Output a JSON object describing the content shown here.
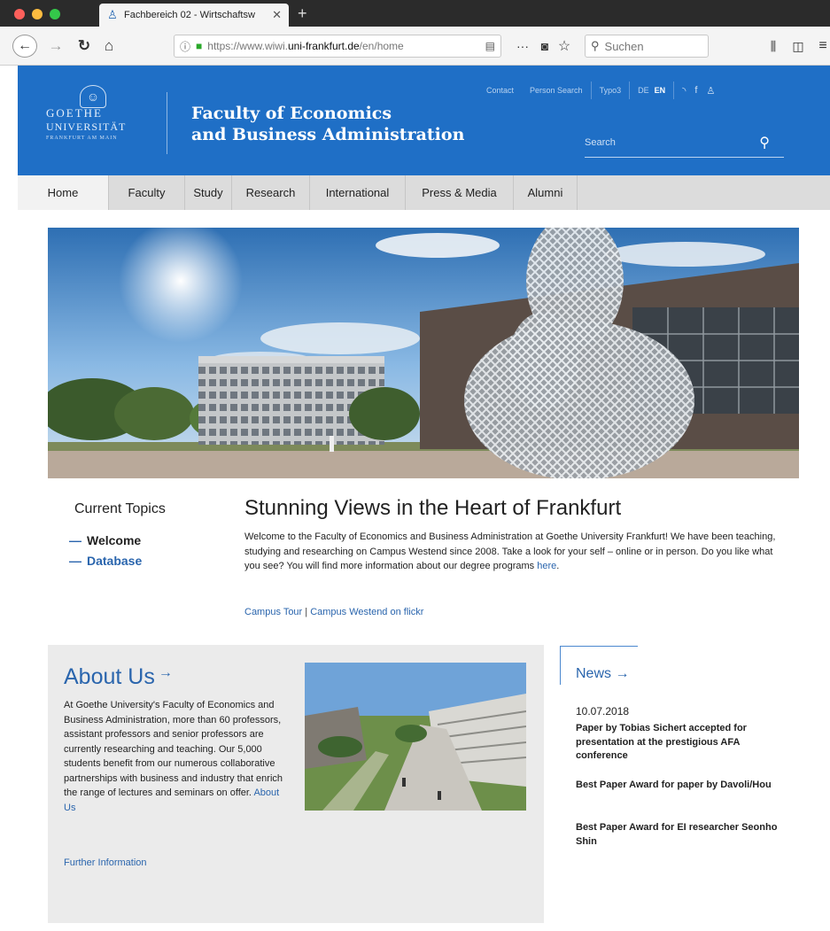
{
  "browser": {
    "tab_title": "Fachbereich 02 - Wirtschaftsw",
    "tab_close": "✕",
    "new_tab": "+",
    "url_prefix": "https://www.wiwi.",
    "url_domain": "uni-frankfurt.de",
    "url_path": "/en/home",
    "search_placeholder": "Suchen",
    "more_label": "···"
  },
  "header": {
    "logo_line1": "GOETHE",
    "logo_line2": "UNIVERSITÄT",
    "logo_line3": "FRANKFURT AM MAIN",
    "faculty_line1": "Faculty of Economics",
    "faculty_line2": "and Business Administration",
    "util_links": [
      "Contact",
      "Person Search",
      "Typo3"
    ],
    "lang_de": "DE",
    "lang_en": "EN",
    "search_label": "Search"
  },
  "nav": {
    "items": [
      "Home",
      "Faculty",
      "Study",
      "Research",
      "International",
      "Press & Media",
      "Alumni"
    ]
  },
  "topics": {
    "heading": "Current Topics",
    "items": [
      "Welcome",
      "Database"
    ],
    "dash": "—"
  },
  "intro": {
    "title": "Stunning Views in the Heart of Frankfurt",
    "text": "Welcome to the Faculty of Economics and Business Administration at Goethe University Frankfurt! We have been teaching, studying and researching on Campus Westend since 2008. Take a look for your self – online or in person. Do you like what you see? You will find more information about our degree programs ",
    "here_link": "here",
    "text_end": ".",
    "campus_tour": "Campus Tour",
    "link_separator": " | ",
    "campus_flickr": "Campus Westend on flickr"
  },
  "about": {
    "title": "About Us",
    "arrow": "→",
    "text": "At Goethe University's Faculty of Economics and Business Administration, more than 60 professors, assistant professors and senior professors are currently researching and teaching. Our 5,000 students benefit from our numerous collaborative partnerships with business and industry that enrich the range of lectures and seminars on offer. ",
    "about_link": "About Us",
    "further_info": "Further Information"
  },
  "news": {
    "title": "News →",
    "date": "10.07.2018",
    "items": [
      "Paper by Tobias Sichert accepted for presentation at the prestigious AFA conference",
      "Best Paper Award for paper by Davoli/Hou",
      "Best Paper Award for EI researcher Seonho Shin"
    ]
  },
  "colors": {
    "brand_blue": "#1f6fc6",
    "link_blue": "#2a65ad",
    "nav_gray": "#dcdcdc",
    "box_gray": "#ebebeb"
  },
  "icons": {
    "back": "back-arrow-icon",
    "forward": "forward-arrow-icon",
    "reload": "reload-icon",
    "home": "home-icon",
    "lock": "lock-icon",
    "search": "search-icon",
    "rss": "rss-icon",
    "facebook": "facebook-icon",
    "person": "person-icon"
  }
}
